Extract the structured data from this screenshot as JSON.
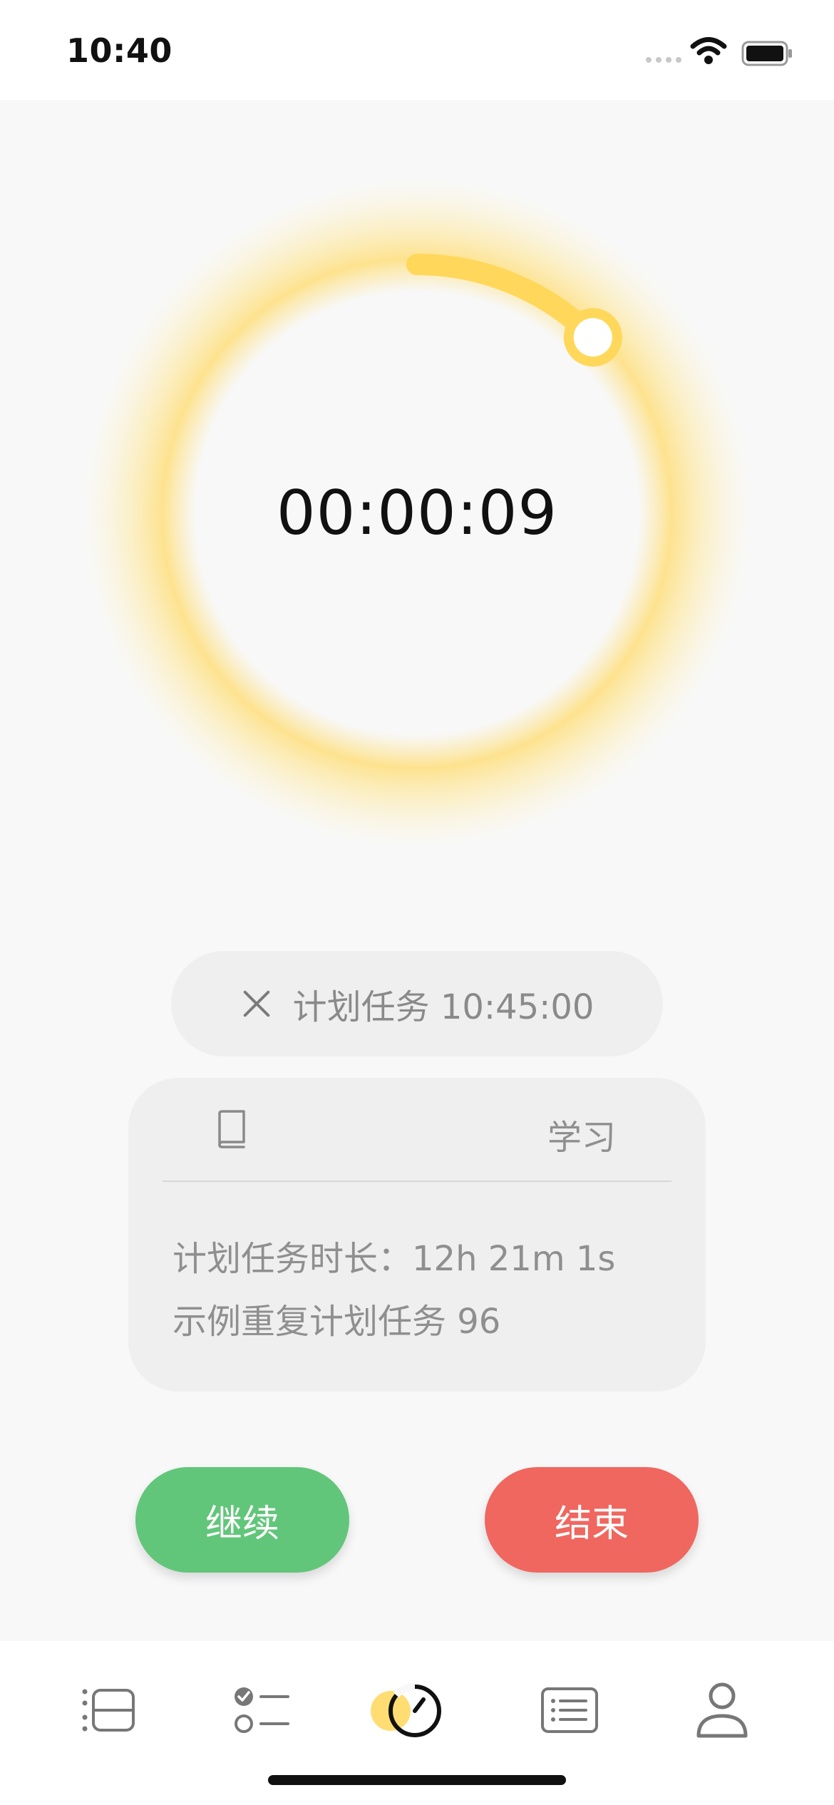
{
  "status_bar": {
    "time": "10:40"
  },
  "timer": {
    "elapsed": "00:00:09",
    "progress_fraction": 0.125,
    "accent_color": "#ffd75a"
  },
  "plan": {
    "label": "计划任务 10:45:00"
  },
  "task_card": {
    "category": "学习",
    "duration_line": "计划任务时长：12h 21m 1s",
    "name_line": "示例重复计划任务 96"
  },
  "buttons": {
    "continue": "继续",
    "end": "结束"
  },
  "colors": {
    "continue": "#62c67a",
    "end": "#ef675f",
    "tab_active_accent": "#ffd75a"
  },
  "tabs": [
    {
      "icon": "timeline-icon",
      "active": false
    },
    {
      "icon": "checklist-icon",
      "active": false
    },
    {
      "icon": "timer-icon",
      "active": true
    },
    {
      "icon": "list-document-icon",
      "active": false
    },
    {
      "icon": "profile-icon",
      "active": false
    }
  ]
}
